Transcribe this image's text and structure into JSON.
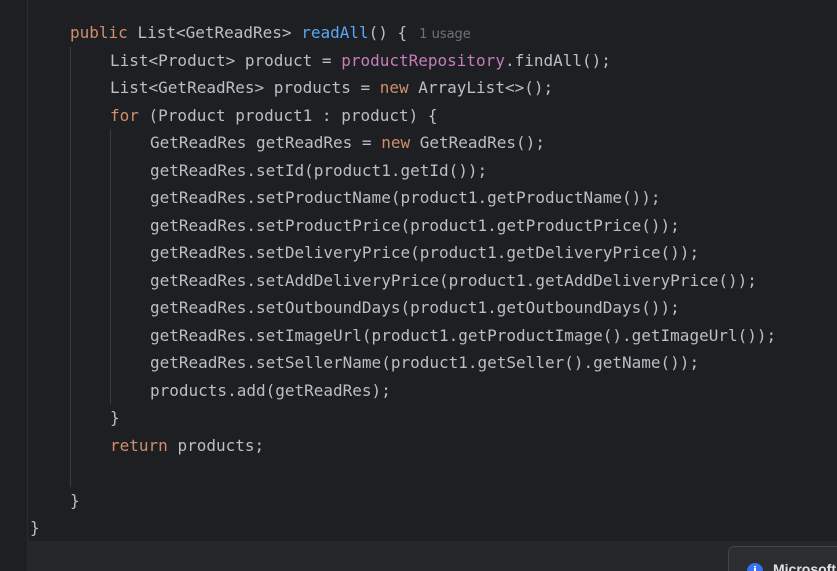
{
  "editor": {
    "inline_hint": "1 usage",
    "code_lines": [
      [
        [
          "kw",
          "public "
        ],
        [
          "plain",
          "List<GetReadRes> "
        ],
        [
          "fn",
          "readAll"
        ],
        [
          "plain",
          "() {"
        ]
      ],
      [
        [
          "plain",
          "List<Product> product = "
        ],
        [
          "field",
          "productRepository"
        ],
        [
          "plain",
          ".findAll();"
        ]
      ],
      [
        [
          "plain",
          "List<GetReadRes> products = "
        ],
        [
          "kw",
          "new "
        ],
        [
          "plain",
          "ArrayList<>();"
        ]
      ],
      [
        [
          "kw",
          "for "
        ],
        [
          "plain",
          "(Product product1 : product) {"
        ]
      ],
      [
        [
          "plain",
          "GetReadRes getReadRes = "
        ],
        [
          "kw",
          "new "
        ],
        [
          "plain",
          "GetReadRes();"
        ]
      ],
      [
        [
          "plain",
          "getReadRes.setId(product1.getId());"
        ]
      ],
      [
        [
          "plain",
          "getReadRes.setProductName(product1.getProductName());"
        ]
      ],
      [
        [
          "plain",
          "getReadRes.setProductPrice(product1.getProductPrice());"
        ]
      ],
      [
        [
          "plain",
          "getReadRes.setDeliveryPrice(product1.getDeliveryPrice());"
        ]
      ],
      [
        [
          "plain",
          "getReadRes.setAddDeliveryPrice(product1.getAddDeliveryPrice());"
        ]
      ],
      [
        [
          "plain",
          "getReadRes.setOutboundDays(product1.getOutboundDays());"
        ]
      ],
      [
        [
          "plain",
          "getReadRes.setImageUrl(product1.getProductImage().getImageUrl());"
        ]
      ],
      [
        [
          "plain",
          "getReadRes.setSellerName(product1.getSeller().getName());"
        ]
      ],
      [
        [
          "plain",
          "products.add(getReadRes);"
        ]
      ],
      [
        [
          "plain",
          "}"
        ]
      ],
      [
        [
          "kw",
          "return "
        ],
        [
          "plain",
          "products;"
        ]
      ],
      [],
      [
        [
          "plain",
          "}"
        ]
      ],
      [
        [
          "plain",
          "}"
        ]
      ]
    ]
  },
  "toast": {
    "title": "Microsoft",
    "icon": "info-icon"
  },
  "colors": {
    "background": "#1e1f22",
    "keyword": "#cf8e6d",
    "method_declaration": "#56a8f5",
    "field": "#c77dbb",
    "text": "#bcbec4",
    "hint": "#6f737a"
  }
}
